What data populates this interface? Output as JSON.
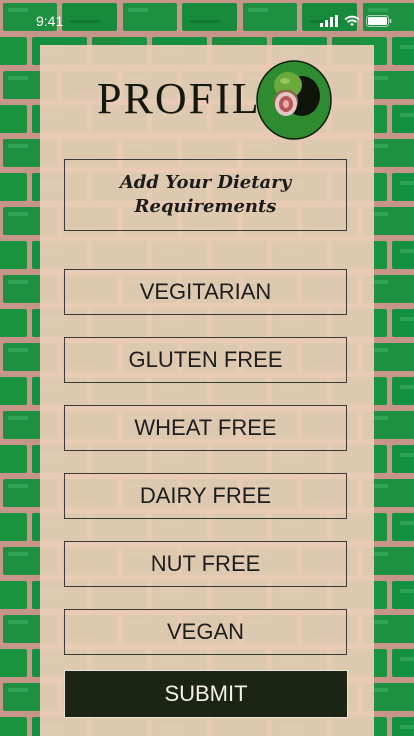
{
  "status_bar": {
    "time": "9:41"
  },
  "header": {
    "title": "PROFILE"
  },
  "subtitle": {
    "line1": "Add Your Dietary",
    "line2": "Requirements"
  },
  "options": [
    {
      "label": "VEGITARIAN"
    },
    {
      "label": "GLUTEN FREE"
    },
    {
      "label": "WHEAT FREE"
    },
    {
      "label": "DAIRY FREE"
    },
    {
      "label": "NUT FREE"
    },
    {
      "label": "VEGAN"
    }
  ],
  "submit": {
    "label": "SUBMIT"
  },
  "colors": {
    "accent": "#1c2414",
    "logo_bg": "#2a8a2a",
    "brick": "#1f8a3e"
  },
  "icons": {
    "logo": "fig-icon"
  }
}
